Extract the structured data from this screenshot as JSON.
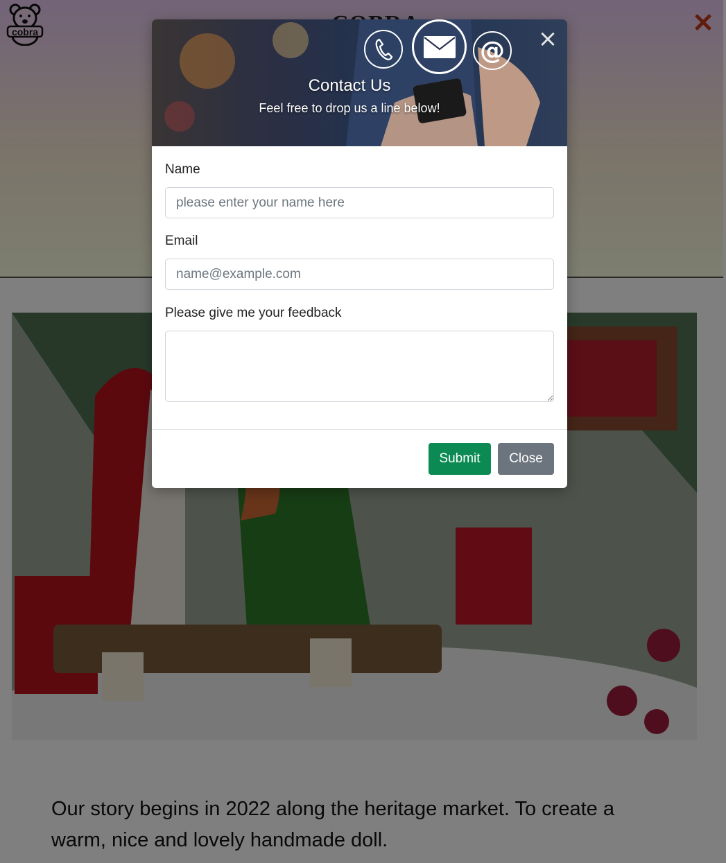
{
  "header": {
    "logo_text": "cobra",
    "brand": "COBRA",
    "close_symbol": "✕"
  },
  "story": {
    "text": "Our story begins in 2022 along the heritage market. To create a warm, nice and lovely handmade doll."
  },
  "modal": {
    "icons": [
      "phone-icon",
      "envelope-icon",
      "at-sign-icon"
    ],
    "at_symbol": "@",
    "close_symbol": "×",
    "title": "Contact Us",
    "subtitle": "Feel free to drop us a line below!",
    "name_label": "Name",
    "name_placeholder": "please enter your name here",
    "email_label": "Email",
    "email_placeholder": "name@example.com",
    "feedback_label": "Please give me your feedback",
    "submit_label": "Submit",
    "close_label": "Close"
  },
  "colors": {
    "submit": "#0b8a53",
    "close": "#6c757d",
    "menu_close": "#c0391b"
  }
}
